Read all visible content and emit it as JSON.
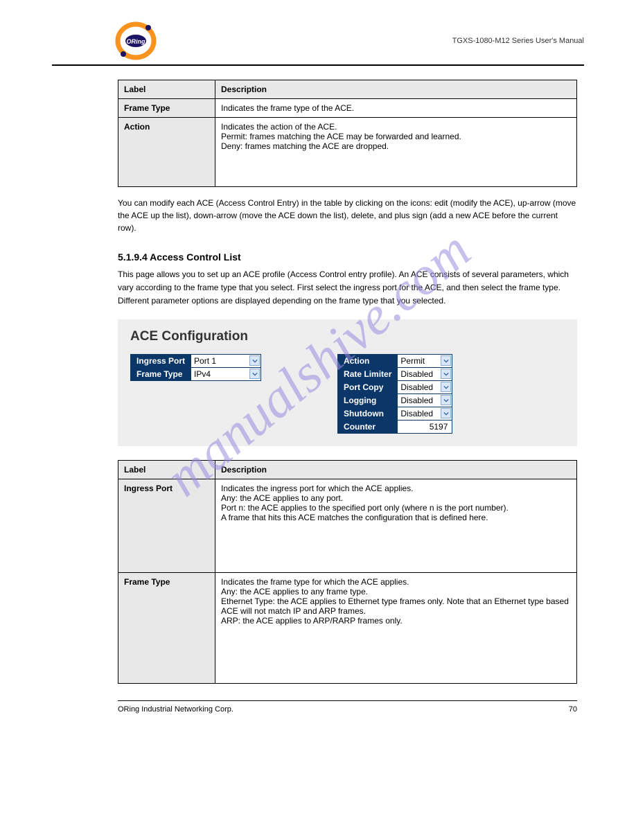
{
  "header_text": "TGXS-1080-M12 Series User's Manual",
  "table1": {
    "hdr_label": "Label",
    "hdr_desc": "Description",
    "row1_label": "Frame Type",
    "row1_desc": "Indicates the frame type of the ACE.",
    "row2_label": "Action",
    "row2_desc": "Indicates the action of the ACE.",
    "row2_line2": "Permit: frames matching the ACE may be forwarded and learned.",
    "row2_line3": "Deny: frames matching the ACE are dropped."
  },
  "note": "You can modify each ACE (Access Control Entry) in the table by clicking on the icons: edit (modify the ACE), up-arrow (move the ACE up the list), down-arrow (move the ACE down the list), delete, and plus sign (add a new ACE before the current row).",
  "section_title": "5.1.9.4 Access Control List",
  "body": "This page allows you to set up an ACE profile (Access Control entry profile). An ACE consists of several parameters, which vary according to the frame type that you select. First select the ingress port for the ACE, and then select the frame type. Different parameter options are displayed depending on the frame type that you selected.",
  "ss": {
    "title": "ACE Configuration",
    "left": {
      "ingress_port_label": "Ingress Port",
      "ingress_port_value": "Port 1",
      "frame_type_label": "Frame Type",
      "frame_type_value": "IPv4"
    },
    "right": {
      "action_label": "Action",
      "action_value": "Permit",
      "rate_limiter_label": "Rate Limiter",
      "rate_limiter_value": "Disabled",
      "port_copy_label": "Port Copy",
      "port_copy_value": "Disabled",
      "logging_label": "Logging",
      "logging_value": "Disabled",
      "shutdown_label": "Shutdown",
      "shutdown_value": "Disabled",
      "counter_label": "Counter",
      "counter_value": "5197"
    }
  },
  "table2": {
    "hdr_label": "Label",
    "hdr_desc": "Description",
    "r1_label": "Ingress Port",
    "r1_l1": "Indicates the ingress port for which the ACE applies.",
    "r1_l2": "Any: the ACE applies to any port.",
    "r1_l3": "Port n: the ACE applies to the specified port only (where n is the port number).",
    "r1_l4": "A frame that hits this ACE matches the configuration that is defined here.",
    "r2_label": "Frame Type",
    "r2_l1": "Indicates the frame type for which the ACE applies.",
    "r2_l2": "Any: the ACE applies to any frame type.",
    "r2_l3": "Ethernet Type: the ACE applies to Ethernet type frames only. Note that an Ethernet type based ACE will not match IP and ARP frames.",
    "r2_l4": "ARP: the ACE applies to ARP/RARP frames only."
  },
  "footer_left": "ORing Industrial Networking Corp.",
  "footer_right": "70",
  "watermark": "manualshive.com"
}
